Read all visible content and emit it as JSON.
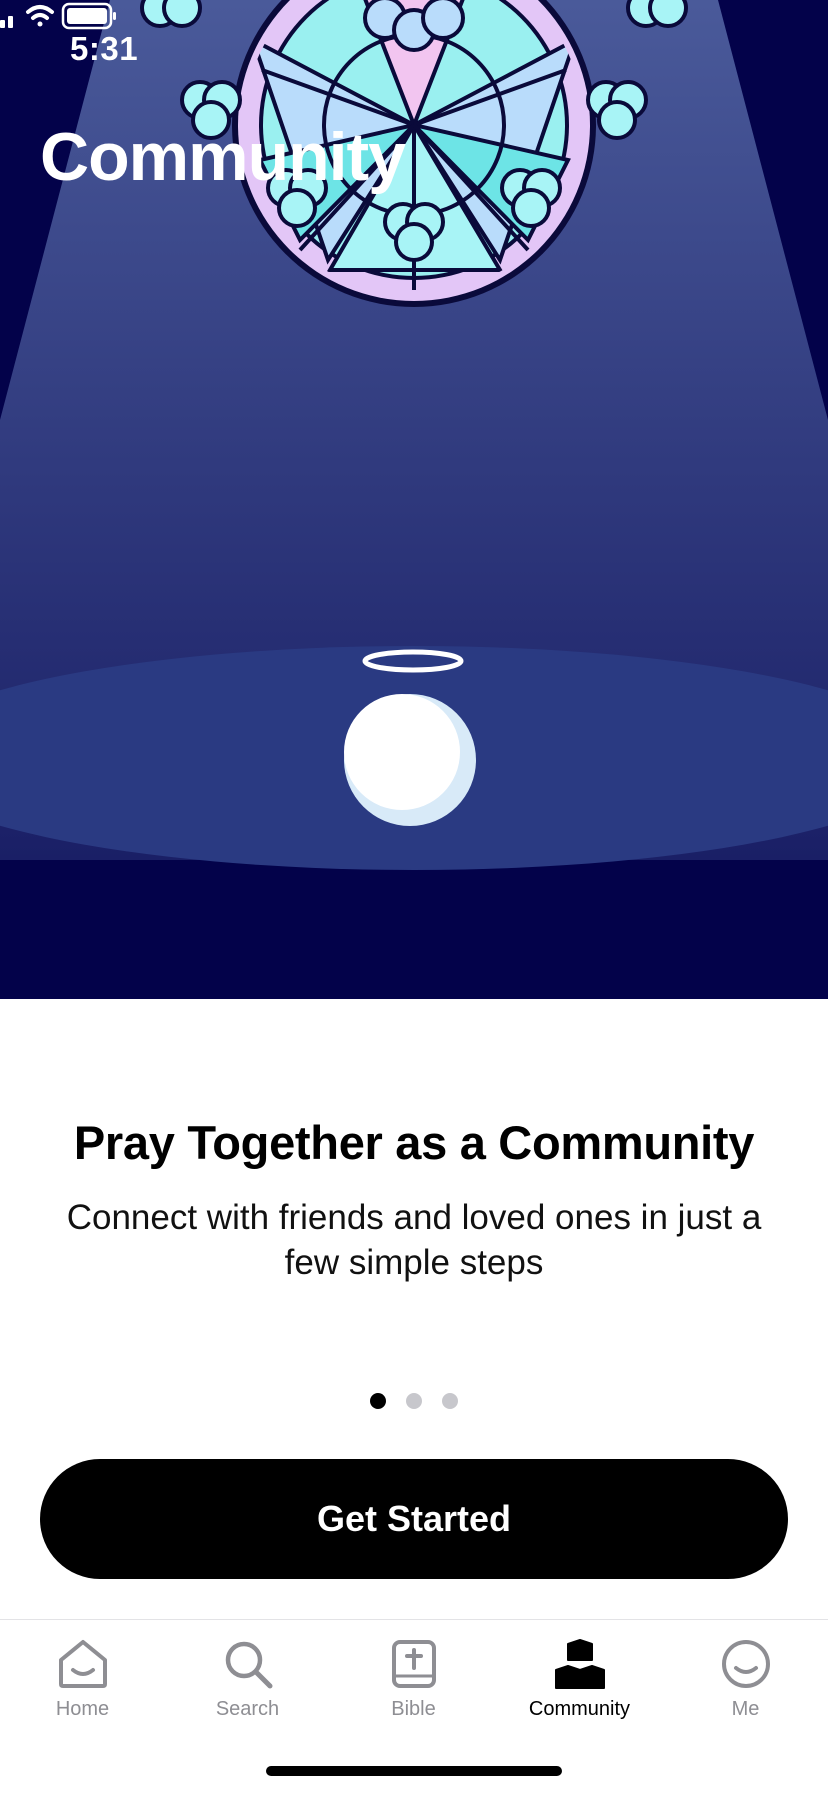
{
  "status_bar": {
    "time": "5:31"
  },
  "nav": {
    "title": "Community"
  },
  "onboarding": {
    "headline": "Pray Together as a Community",
    "subline": "Connect with friends and loved ones in just a few simple steps",
    "page_count": 3,
    "current_page": 1,
    "cta_label": "Get Started"
  },
  "tabs": [
    {
      "label": "Home",
      "icon": "home-face-icon"
    },
    {
      "label": "Search",
      "icon": "search-icon"
    },
    {
      "label": "Bible",
      "icon": "bible-icon"
    },
    {
      "label": "Community",
      "icon": "community-icon"
    },
    {
      "label": "Me",
      "icon": "profile-face-icon"
    }
  ],
  "colors": {
    "hero_background": "#03024a",
    "spotlight": "#2a3a82",
    "window_lavender": "#e3c6f7",
    "window_cyan": "#a8f4f6",
    "window_blue": "#b9dcfb",
    "accent": "#000000",
    "tab_inactive": "#8e8e93"
  }
}
